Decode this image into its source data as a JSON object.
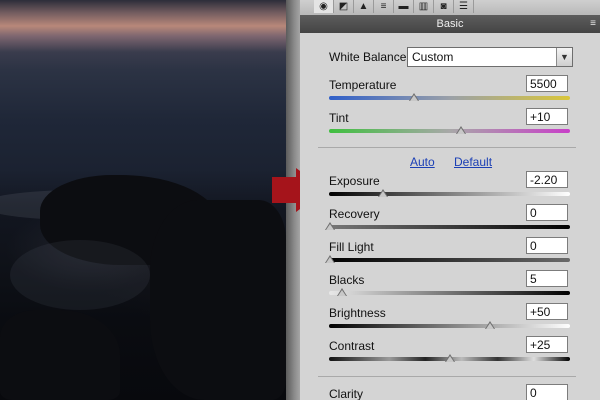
{
  "panel": {
    "header": "Basic",
    "menu_glyph": "≡",
    "tabs": [
      "basic-icon",
      "tone-curve-icon",
      "detail-icon",
      "hsl-icon",
      "split-tone-icon",
      "lens-icon",
      "camera-icon",
      "presets-icon"
    ]
  },
  "white_balance": {
    "label": "White Balance:",
    "value": "Custom",
    "dropdown_glyph": "▼"
  },
  "controls": {
    "temperature": {
      "label": "Temperature",
      "value": "5500",
      "position": 0.36
    },
    "tint": {
      "label": "Tint",
      "value": "+10",
      "position": 0.55
    },
    "exposure": {
      "label": "Exposure",
      "value": "-2.20",
      "position": 0.23
    },
    "recovery": {
      "label": "Recovery",
      "value": "0",
      "position": 0.0
    },
    "fill_light": {
      "label": "Fill Light",
      "value": "0",
      "position": 0.0
    },
    "blacks": {
      "label": "Blacks",
      "value": "5",
      "position": 0.05
    },
    "brightness": {
      "label": "Brightness",
      "value": "+50",
      "position": 0.67
    },
    "contrast": {
      "label": "Contrast",
      "value": "+25",
      "position": 0.5
    },
    "clarity": {
      "label": "Clarity",
      "value": "0"
    }
  },
  "links": {
    "auto": "Auto",
    "default": "Default"
  },
  "colors": {
    "arrow": "#a5141b",
    "link": "#1b3fb5",
    "panel_bg": "#d4d4d4"
  }
}
